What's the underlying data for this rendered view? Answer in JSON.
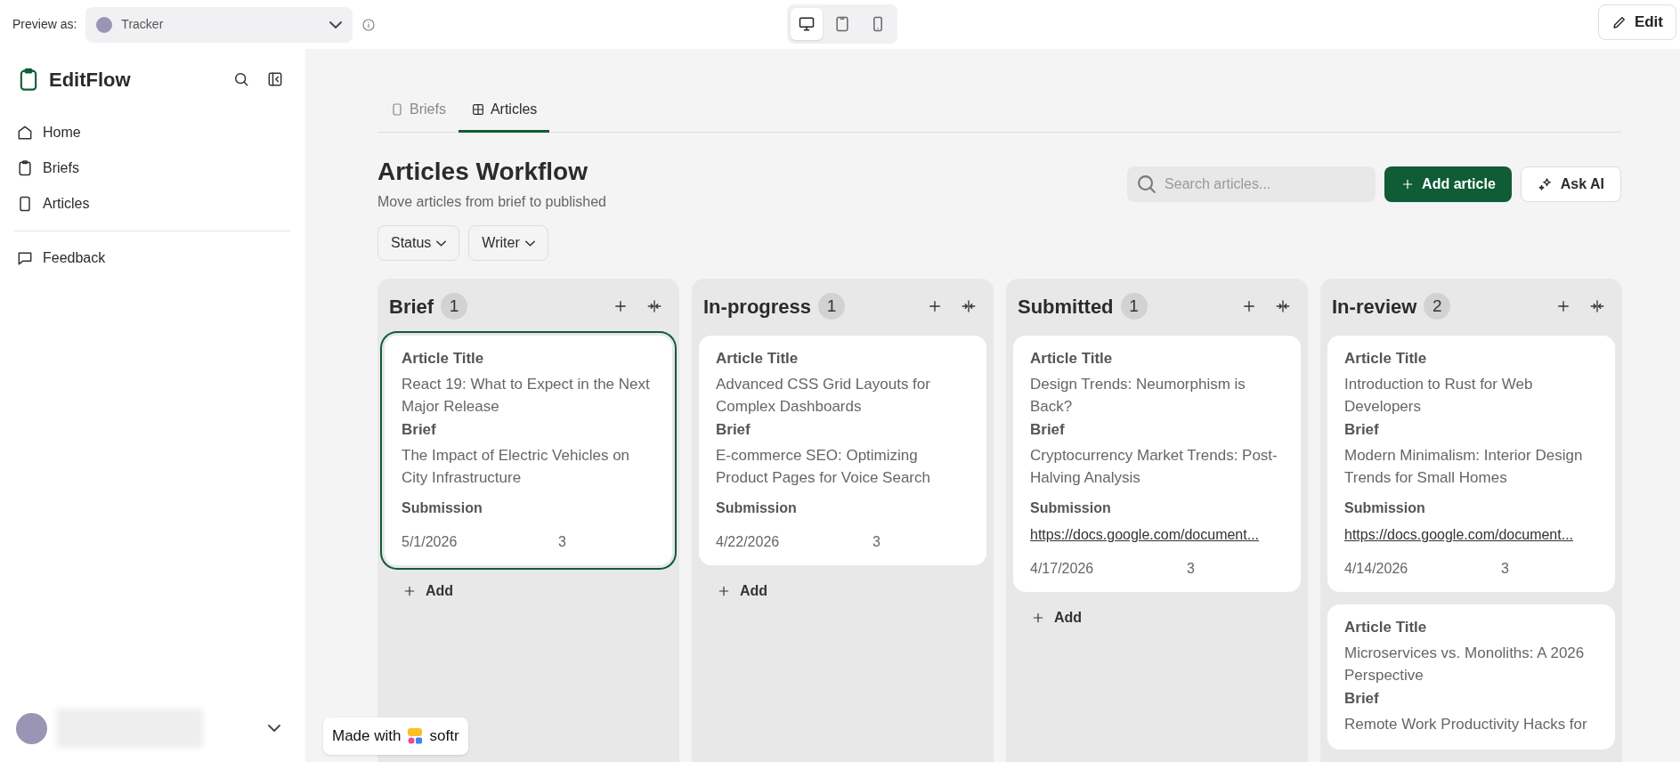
{
  "top_bar": {
    "preview_label": "Preview as:",
    "preview_select": {
      "value": "Tracker",
      "color": "#9b95b5"
    },
    "devices": [
      {
        "kind": "desktop",
        "selected": true
      },
      {
        "kind": "tablet",
        "selected": false
      },
      {
        "kind": "phone",
        "selected": false
      }
    ],
    "edit_button": "Edit"
  },
  "sidebar": {
    "app_name": "EditFlow",
    "items": [
      {
        "label": "Home"
      },
      {
        "label": "Briefs"
      },
      {
        "label": "Articles"
      }
    ],
    "secondary_items": [
      {
        "label": "Feedback"
      }
    ]
  },
  "tabs": [
    {
      "label": "Briefs",
      "selected": false
    },
    {
      "label": "Articles",
      "selected": true
    }
  ],
  "header": {
    "title": "Articles Workflow",
    "subtitle": "Move articles from brief to published",
    "search": {
      "placeholder": "Search articles..."
    },
    "add_button": "Add article",
    "ai_button": "Ask AI"
  },
  "filters": [
    "Status",
    "Writer"
  ],
  "columns": [
    {
      "title": "Brief",
      "count": "1",
      "add_label": "Add",
      "cards": [
        {
          "selected": true,
          "title_label": "Article Title",
          "title": "React 19: What to Expect in the Next Major Release",
          "brief_label": "Brief",
          "brief": "The Impact of Electric Vehicles on City Infrastructure",
          "submission_label": "Submission",
          "date": "5/1/2026",
          "number": "3"
        }
      ]
    },
    {
      "title": "In-progress",
      "count": "1",
      "add_label": "Add",
      "cards": [
        {
          "selected": false,
          "title_label": "Article Title",
          "title": "Advanced CSS Grid Layouts for Complex Dashboards",
          "brief_label": "Brief",
          "brief": "E-commerce SEO: Optimizing Product Pages for Voice Search",
          "submission_label": "Submission",
          "date": "4/22/2026",
          "number": "3"
        }
      ]
    },
    {
      "title": "Submitted",
      "count": "1",
      "add_label": "Add",
      "cards": [
        {
          "selected": false,
          "title_label": "Article Title",
          "title": "Design Trends: Neumorphism is Back?",
          "brief_label": "Brief",
          "brief": "Cryptocurrency Market Trends: Post-Halving Analysis",
          "submission_label": "Submission",
          "submission": "https://docs.google.com/document...",
          "date": "4/17/2026",
          "number": "3"
        }
      ]
    },
    {
      "title": "In-review",
      "count": "2",
      "cards": [
        {
          "selected": false,
          "title_label": "Article Title",
          "title": "Introduction to Rust for Web Developers",
          "brief_label": "Brief",
          "brief": "Modern Minimalism: Interior Design Trends for Small Homes",
          "submission_label": "Submission",
          "submission": "https://docs.google.com/document...",
          "date": "4/14/2026",
          "number": "3"
        },
        {
          "selected": false,
          "title_label": "Article Title",
          "title": "Microservices vs. Monoliths: A 2026 Perspective",
          "brief_label": "Brief",
          "brief": "Remote Work Productivity Hacks for"
        }
      ]
    }
  ],
  "badge": {
    "made_with": "Made with",
    "brand": "softr"
  }
}
